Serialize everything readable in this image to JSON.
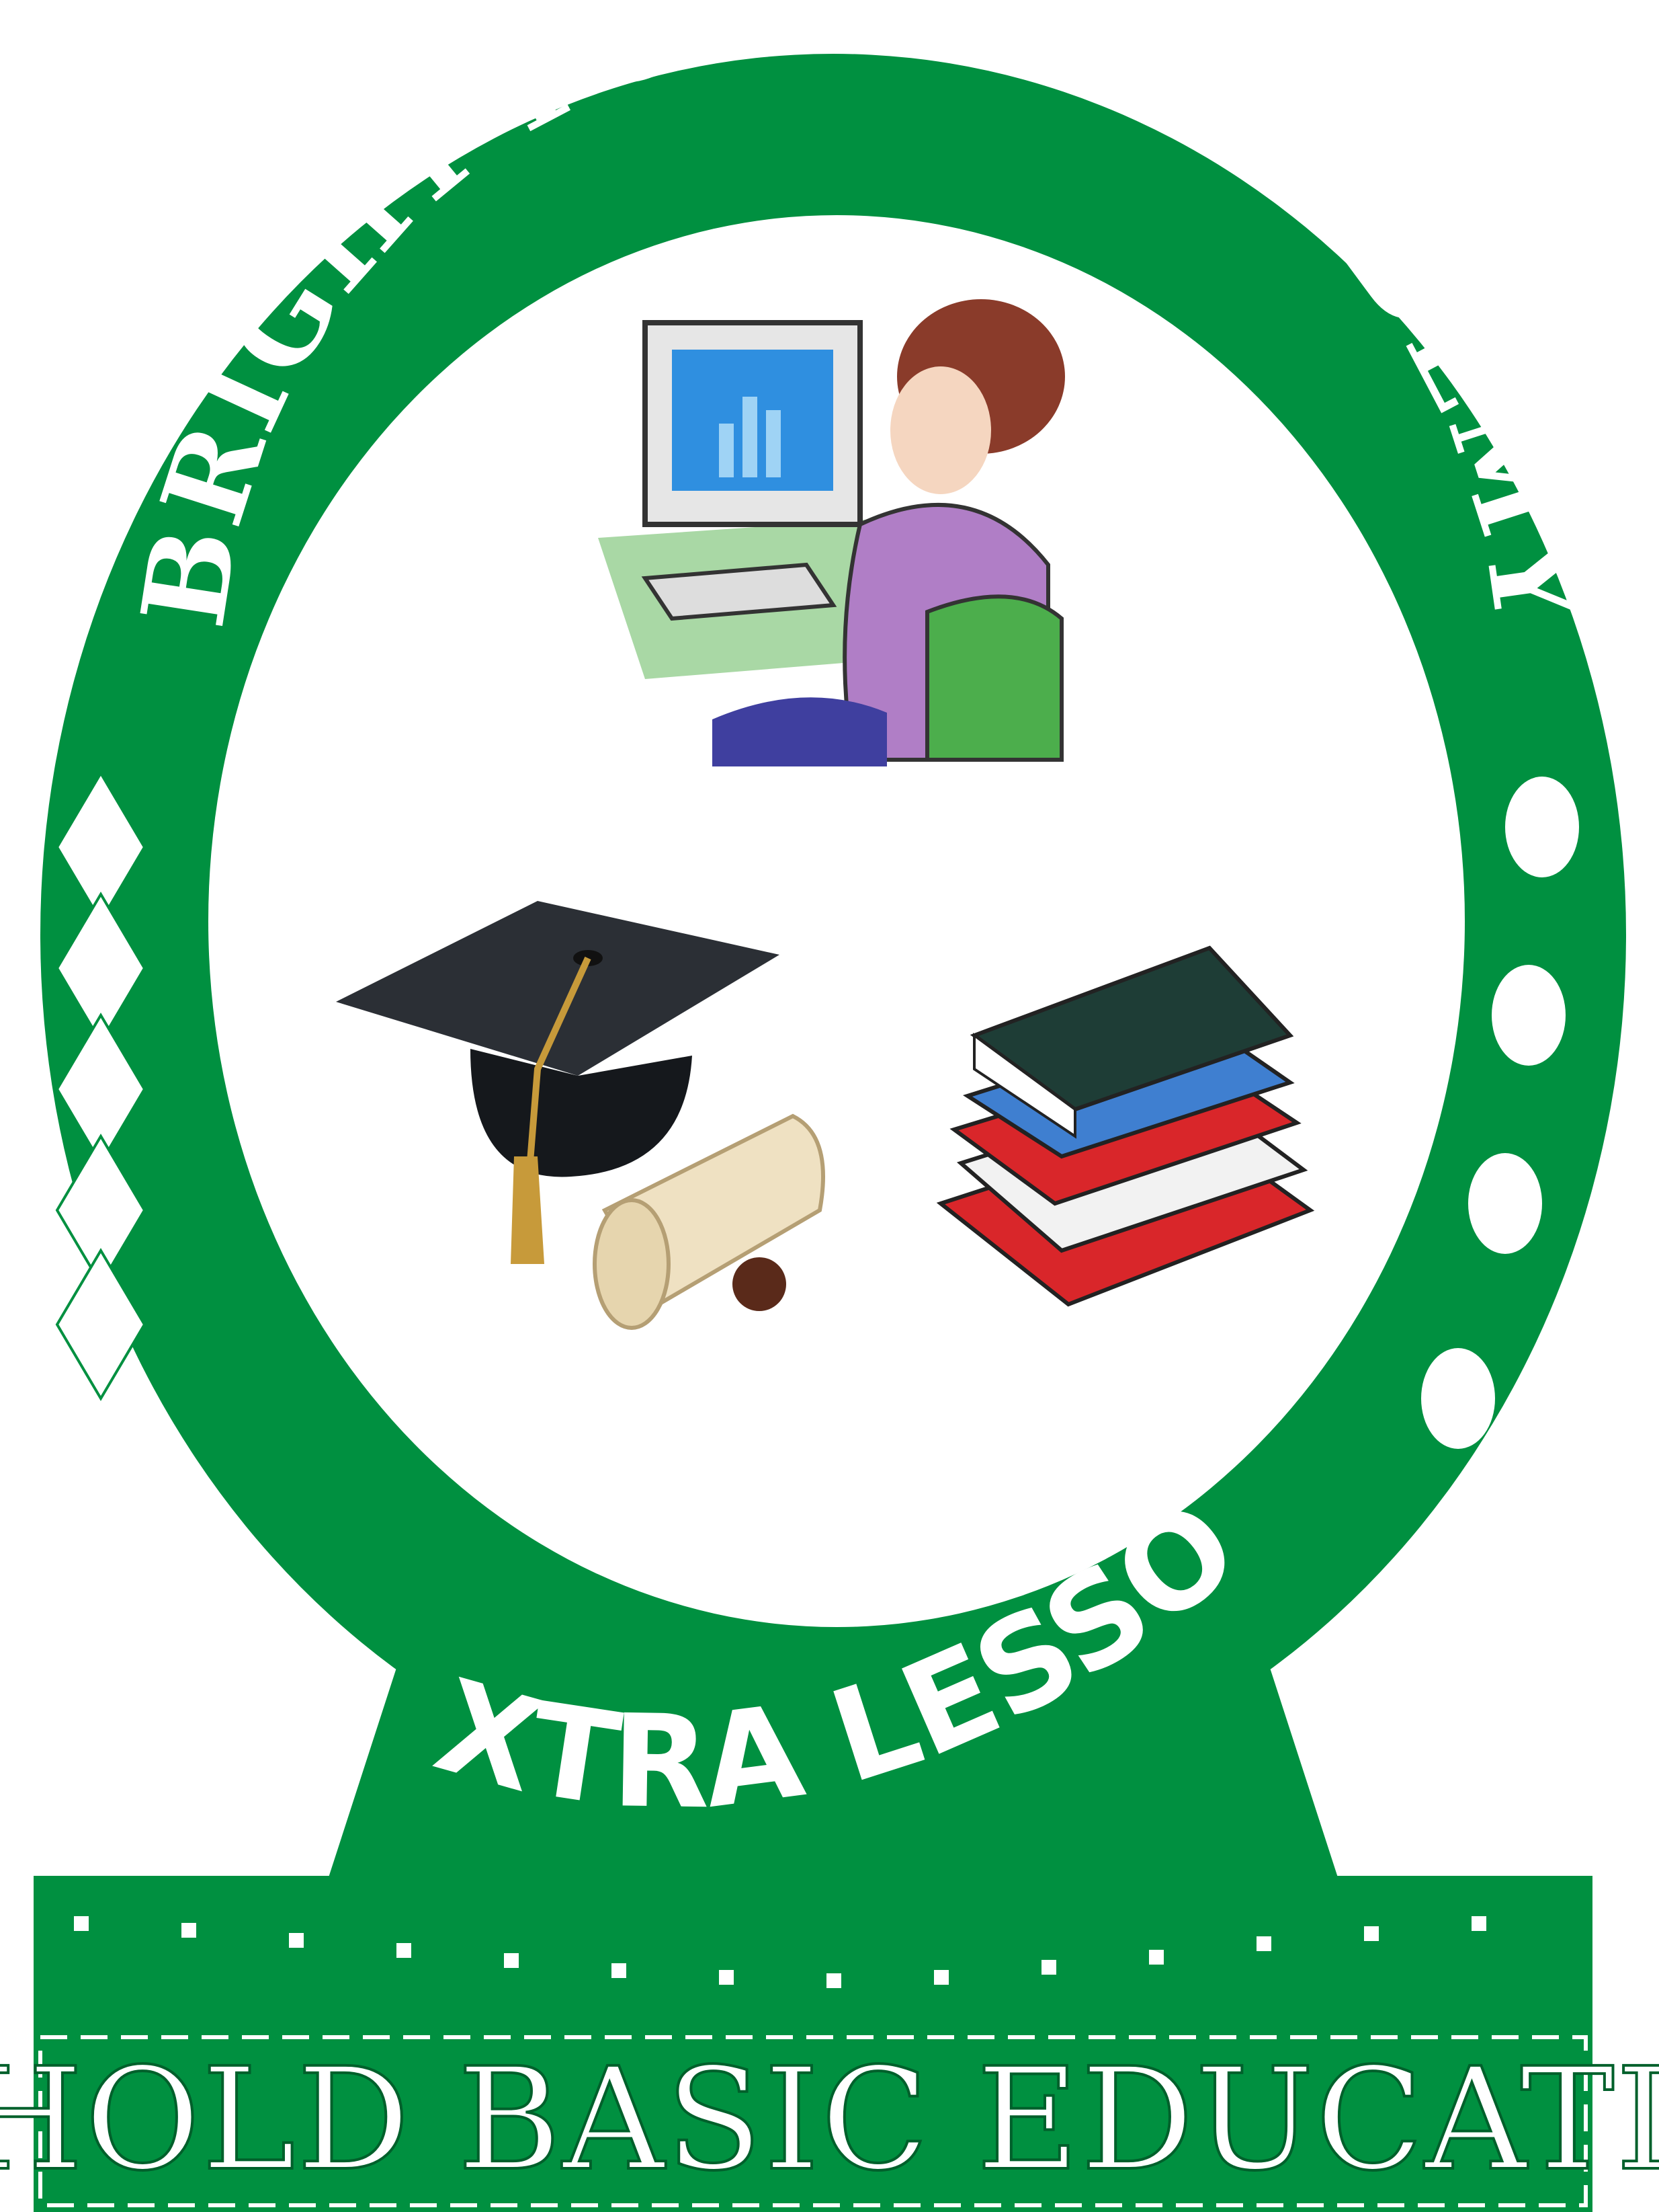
{
  "logo": {
    "school_name": "BRIGHT FUTURE ACADEMY",
    "program": "EXTRA LESSON",
    "motto": "UPHOLD BASIC EDUCATION"
  },
  "icons": [
    "computer-user-icon",
    "graduation-cap-icon",
    "diploma-scroll-icon",
    "book-stack-icon"
  ],
  "colors": {
    "primary_green": "#009040",
    "white": "#ffffff",
    "accent_purple": "#b07ec6",
    "hair_brown": "#8a3b2a",
    "screen_blue": "#2f8fe0",
    "book_red": "#d9262a",
    "book_blue": "#3f7fd0",
    "book_dark": "#1e3d36"
  }
}
